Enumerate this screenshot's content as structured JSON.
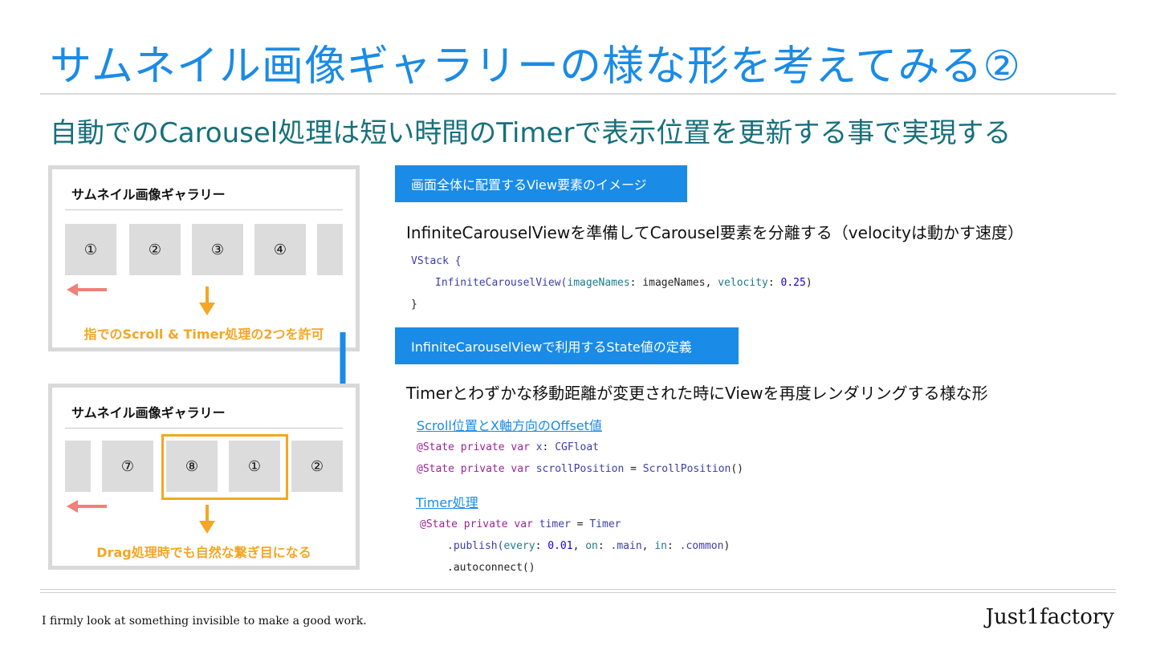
{
  "slide": {
    "title": "サムネイル画像ギャラリーの様な形を考えてみる②",
    "subtitle": "自動でのCarousel処理は短い時間のTimerで表示位置を更新する事で実現する"
  },
  "panel_top": {
    "title": "サムネイル画像ギャラリー",
    "thumbs": [
      "①",
      "②",
      "③",
      "④",
      ""
    ],
    "caption": "指でのScroll & Timer処理の2つを許可"
  },
  "panel_bottom": {
    "title": "サムネイル画像ギャラリー",
    "thumbs": [
      "",
      "⑦",
      "⑧",
      "①",
      "②"
    ],
    "caption": "Drag処理時でも自然な繋ぎ目になる"
  },
  "section1": {
    "tag": "画面全体に配置するView要素のイメージ",
    "description": "InfiniteCarouselViewを準備してCarousel要素を分離する（velocityは動かす速度）",
    "code": {
      "line1": "VStack {",
      "line2_fn": "InfiniteCarouselView(",
      "line2_label1": "imageNames",
      "line2_mid": ": imageNames, ",
      "line2_label2": "velocity",
      "line2_colon": ": ",
      "line2_num": "0.25",
      "line2_end": ")",
      "line3": "}"
    }
  },
  "section2": {
    "tag": "InfiniteCarouselViewで利用するState値の定義",
    "description": "Timerとわずかな移動距離が変更された時にViewを再度レンダリングする様な形",
    "link1": "Scroll位置とX軸方向のOffset値",
    "code1": {
      "attr": "@State",
      "kw": "private var",
      "v1": "x",
      "t1": "CGFloat",
      "v2": "scrollPosition",
      "eq": " = ",
      "t2": "ScrollPosition",
      "paren": "()"
    },
    "link2": "Timer処理",
    "code2": {
      "attr": "@State",
      "kw": "private var",
      "v": "timer",
      "eq": " = ",
      "t": "Timer",
      "publish": ".publish(",
      "every": "every",
      "every_val": "0.01",
      "on": "on",
      "on_val": ".main",
      "in": "in",
      "in_val": ".common",
      "close": ")",
      "autoconnect": ".autoconnect()"
    }
  },
  "footer": {
    "tagline": "I firmly look at something invisible to make a good work.",
    "brand": "Just1factory"
  },
  "colors": {
    "title_blue": "#1a8be6",
    "subtitle_teal": "#17707a",
    "accent_orange": "#f5a623",
    "arrow_salmon": "#f08078",
    "thumb_gray": "#dcdcdc"
  }
}
